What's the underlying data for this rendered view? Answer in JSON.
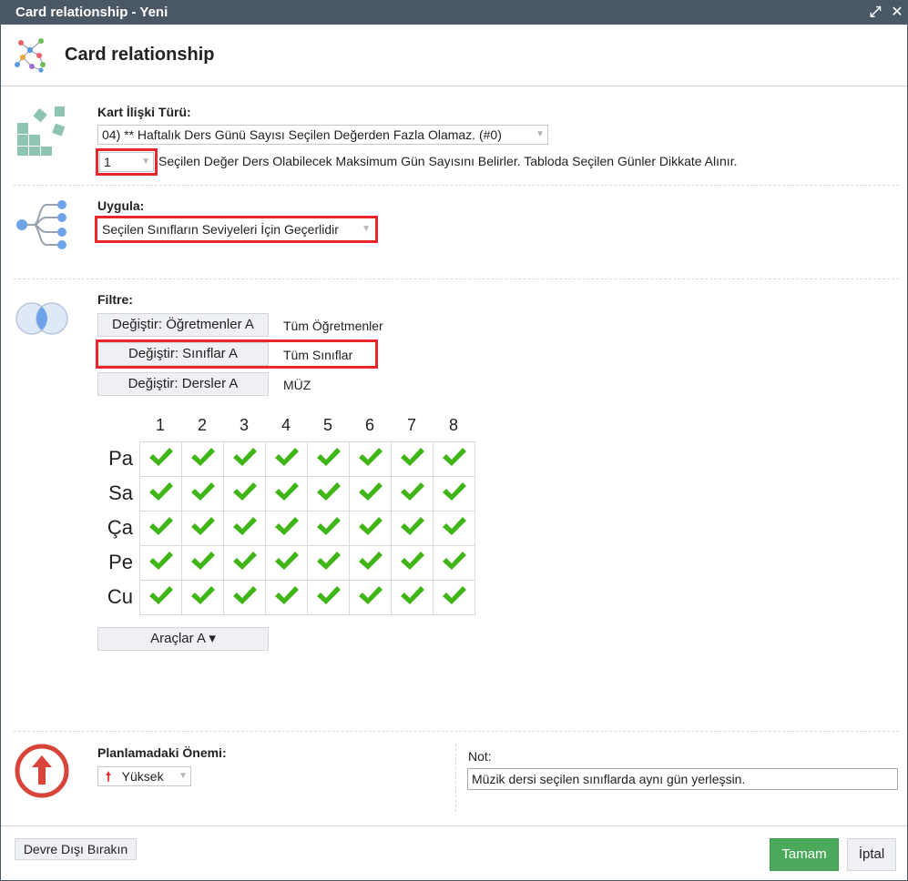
{
  "window": {
    "title": "Card relationship - Yeni"
  },
  "header": {
    "title": "Card relationship",
    "icon": "network-icon"
  },
  "relation_type": {
    "label": "Kart İlişki Türü:",
    "selected": "04) ** Haftalık Ders Günü Sayısı Seçilen Değerden Fazla Olamaz. (#0)",
    "value_select": "1",
    "description": "Seçilen Değer Ders Olabilecek Maksimum Gün Sayısını Belirler. Tabloda Seçilen Günler Dikkate Alınır."
  },
  "apply": {
    "label": "Uygula:",
    "selected": "Seçilen Sınıfların Seviyeleri İçin Geçerlidir"
  },
  "filter": {
    "label": "Filtre:",
    "rows": [
      {
        "button": "Değiştir: Öğretmenler A",
        "value": "Tüm Öğretmenler"
      },
      {
        "button": "Değiştir: Sınıflar A",
        "value": "Tüm Sınıflar"
      },
      {
        "button": "Değiştir: Dersler A",
        "value": "MÜZ"
      }
    ]
  },
  "grid": {
    "columns": [
      "1",
      "2",
      "3",
      "4",
      "5",
      "6",
      "7",
      "8"
    ],
    "rows": [
      "Pa",
      "Sa",
      "Ça",
      "Pe",
      "Cu"
    ],
    "all_checked": true,
    "check_color": "#3fb517"
  },
  "tools_button": "Araçlar A ▾",
  "importance": {
    "label": "Planlamadaki Önemi:",
    "selected": "Yüksek"
  },
  "note": {
    "label": "Not:",
    "value": "Müzik dersi seçilen sınıflarda aynı gün yerleşsin."
  },
  "footer": {
    "disable_button": "Devre Dışı Bırakın",
    "ok_button": "Tamam",
    "cancel_button": "İptal"
  },
  "colors": {
    "titlebar": "#4a5866",
    "ok": "#4aa95b",
    "highlight": "#e8262b",
    "importance": "#d9443a"
  }
}
